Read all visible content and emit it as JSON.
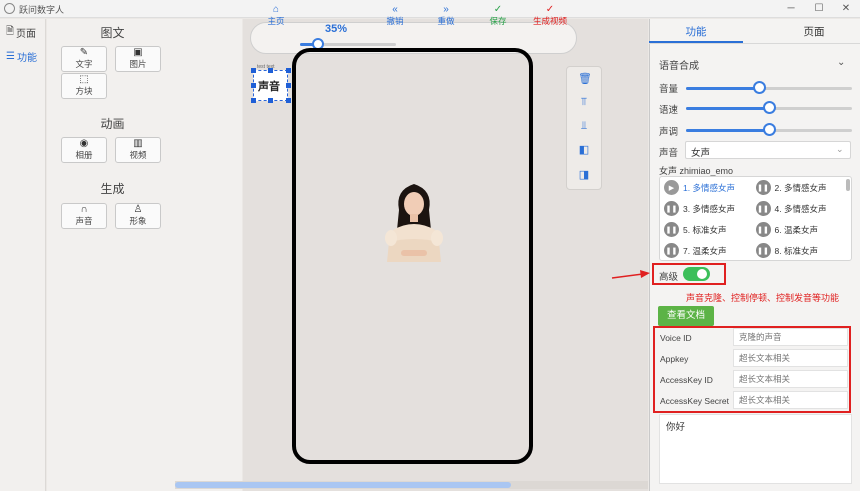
{
  "window": {
    "title": "跃问数字人",
    "min_glyph": "─",
    "max_glyph": "☐",
    "close_glyph": "✕"
  },
  "leftnav": [
    {
      "icon": "page-icon",
      "glyph": "🗎",
      "label": "页面",
      "active": false
    },
    {
      "icon": "function-icon",
      "glyph": "☰",
      "label": "功能",
      "active": true
    }
  ],
  "tools": {
    "sections": [
      {
        "title": "图文",
        "items": [
          {
            "label": "文字",
            "icon": "edit-icon",
            "glyph": "✎"
          },
          {
            "label": "图片",
            "icon": "image-icon",
            "glyph": "▣"
          },
          {
            "label": "方块",
            "icon": "block-icon",
            "glyph": "⬚"
          }
        ]
      },
      {
        "title": "动画",
        "items": [
          {
            "label": "相册",
            "icon": "camera-icon",
            "glyph": "◉"
          },
          {
            "label": "视频",
            "icon": "film-icon",
            "glyph": "▥"
          }
        ]
      },
      {
        "title": "生成",
        "items": [
          {
            "label": "声音",
            "icon": "headphones-icon",
            "glyph": "∩"
          },
          {
            "label": "形象",
            "icon": "person-icon",
            "glyph": "♙"
          }
        ]
      }
    ]
  },
  "toolbar": {
    "zoom_label": "35%",
    "zoom_value": 0.35,
    "items": [
      {
        "label": "主页",
        "glyph": "⌂",
        "color": "#2a6fd6"
      },
      {
        "label": "撤销",
        "glyph": "«",
        "color": "#2a6fd6"
      },
      {
        "label": "重做",
        "glyph": "»",
        "color": "#2a6fd6"
      },
      {
        "label": "保存",
        "glyph": "✓",
        "color": "#2aa24a"
      },
      {
        "label": "生成视频",
        "glyph": "✓",
        "color": "#e02020"
      }
    ]
  },
  "canvas": {
    "selected_element": {
      "tag": "test text",
      "text": "声音"
    }
  },
  "side_tools": [
    {
      "icon": "trash-icon",
      "glyph": "🗑"
    },
    {
      "icon": "align-top-icon",
      "glyph": "⫪"
    },
    {
      "icon": "align-bottom-icon",
      "glyph": "⫫"
    },
    {
      "icon": "bring-forward-icon",
      "glyph": "◧"
    },
    {
      "icon": "send-backward-icon",
      "glyph": "◨"
    }
  ],
  "right_panel": {
    "tabs": [
      "功能",
      "页面"
    ],
    "active_tab": 0,
    "section_title": "语音合成",
    "sliders": [
      {
        "label": "音量",
        "value": 0.44
      },
      {
        "label": "语速",
        "value": 0.5
      },
      {
        "label": "声调",
        "value": 0.5
      }
    ],
    "voice_label": "声音",
    "voice_selected": "女声",
    "voice_group_title": "女声 zhimiao_emo",
    "voice_items": [
      {
        "label": "1. 多情感女声",
        "selected": true
      },
      {
        "label": "2. 多情感女声",
        "selected": false
      },
      {
        "label": "3. 多情感女声",
        "selected": false
      },
      {
        "label": "4. 多情感女声",
        "selected": false
      },
      {
        "label": "5. 标准女声",
        "selected": false
      },
      {
        "label": "6. 温柔女声",
        "selected": false
      },
      {
        "label": "7. 温柔女声",
        "selected": false
      },
      {
        "label": "8. 标准女声",
        "selected": false
      }
    ],
    "advanced_label": "高级",
    "advanced_on": true,
    "advanced_note": "声音克隆、控制停顿、控制发音等功能",
    "doc_button": "查看文档",
    "credentials": [
      {
        "label": "Voice ID",
        "placeholder": "克隆的声音"
      },
      {
        "label": "Appkey",
        "placeholder": "超长文本相关"
      },
      {
        "label": "AccessKey ID",
        "placeholder": "超长文本相关"
      },
      {
        "label": "AccessKey Secret",
        "placeholder": "超长文本相关"
      }
    ],
    "text_content": "你好"
  },
  "colors": {
    "accent": "#2a6fd6",
    "danger": "#e02020",
    "success": "#5cb346"
  }
}
